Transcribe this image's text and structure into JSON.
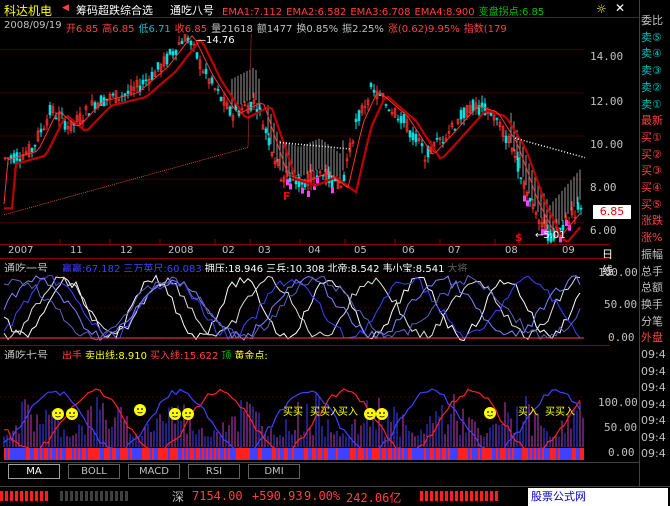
{
  "header": {
    "stock_name": "科达机电",
    "indicator_tabs": [
      "筹码超跌综合选",
      "通吃八号"
    ],
    "ema": [
      {
        "label": "EMA1:7.112",
        "color": "#ff4040"
      },
      {
        "label": "EMA2:6.582",
        "color": "#ff4040"
      },
      {
        "label": "EMA3:6.708",
        "color": "#ff4040"
      },
      {
        "label": "EMA4:8.900",
        "color": "#ff4040"
      },
      {
        "label": "变盘拐点:6.85",
        "color": "#00c000"
      }
    ],
    "date": "2008/09/19",
    "ohlc": [
      {
        "label": "开6.85",
        "color": "#ff4040"
      },
      {
        "label": "高6.85",
        "color": "#ff4040"
      },
      {
        "label": "低6.71",
        "color": "#00c0c0"
      },
      {
        "label": "收6.85",
        "color": "#ff4040"
      },
      {
        "label": "量21618",
        "color": "#c0c0c0"
      },
      {
        "label": "额1477",
        "color": "#c0c0c0"
      },
      {
        "label": "换0.85%",
        "color": "#c0c0c0"
      },
      {
        "label": "振2.25%",
        "color": "#c0c0c0"
      },
      {
        "label": "涨(0.62)9.95%",
        "color": "#ff4040"
      },
      {
        "label": "指数(179",
        "color": "#ff4040"
      }
    ]
  },
  "main_chart": {
    "y_labels": [
      "14.00",
      "12.00",
      "10.00",
      "8.00",
      "6.00"
    ],
    "high_annotation": "14.76",
    "low_annotation": "5.01",
    "current_price": "6.85",
    "x_labels": [
      "2007",
      "11",
      "12",
      "2008",
      "02",
      "03",
      "04",
      "05",
      "06",
      "07",
      "08",
      "09"
    ],
    "period": "日线"
  },
  "sub1": {
    "title": "通吃一号",
    "items": [
      {
        "label": "赢赢:67.182",
        "color": "#4040ff"
      },
      {
        "label": "三万英尺:60.083",
        "color": "#4040ff"
      },
      {
        "label": "拥压:18.946",
        "color": "#ffffff"
      },
      {
        "label": "三兵:10.308",
        "color": "#ffffff"
      },
      {
        "label": "北帝:8.542",
        "color": "#ffffff"
      },
      {
        "label": "韦小宝:8.541",
        "color": "#ffffff"
      },
      {
        "label": "大将",
        "color": "#606060"
      }
    ],
    "y_labels": [
      "100.00",
      "50.00",
      "0.00"
    ]
  },
  "sub2": {
    "title": "通吃七号",
    "items": [
      {
        "label": "出手",
        "color": "#ff4040"
      },
      {
        "label": "卖出线:8.910",
        "color": "#ffff00"
      },
      {
        "label": "买入线:15.622",
        "color": "#ff4040"
      },
      {
        "label": "顶",
        "color": "#00c000"
      },
      {
        "label": "黄金点:",
        "color": "#ffff00"
      }
    ],
    "y_labels": [
      "100.00",
      "50.00",
      "0.00"
    ],
    "buy_labels": [
      "买买",
      "买买入",
      "买入",
      "买入",
      "买买入"
    ]
  },
  "bottom_tabs": [
    "MA",
    "BOLL",
    "MACD",
    "RSI",
    "DMI"
  ],
  "sidebar": {
    "items": [
      {
        "label": "委比",
        "color": "#c0c0c0"
      },
      {
        "label": "卖⑤",
        "color": "#00c0c0"
      },
      {
        "label": "卖④",
        "color": "#00c0c0"
      },
      {
        "label": "卖③",
        "color": "#00c0c0"
      },
      {
        "label": "卖②",
        "color": "#00c0c0"
      },
      {
        "label": "卖①",
        "color": "#00c0c0"
      },
      {
        "label": "最新",
        "color": "#ff4040"
      },
      {
        "label": "买①",
        "color": "#ff4040"
      },
      {
        "label": "买②",
        "color": "#ff4040"
      },
      {
        "label": "买③",
        "color": "#ff4040"
      },
      {
        "label": "买④",
        "color": "#ff4040"
      },
      {
        "label": "买⑤",
        "color": "#ff4040"
      },
      {
        "label": "涨跌",
        "color": "#ff4040"
      },
      {
        "label": "涨%",
        "color": "#ff4040"
      },
      {
        "label": "振幅",
        "color": "#c0c0c0"
      },
      {
        "label": "总手",
        "color": "#c0c0c0"
      },
      {
        "label": "总额",
        "color": "#c0c0c0"
      },
      {
        "label": "换手",
        "color": "#c0c0c0"
      },
      {
        "label": "分笔",
        "color": "#c0c0c0"
      },
      {
        "label": "外盘",
        "color": "#ff4040"
      }
    ],
    "times": [
      "09:4",
      "09:4",
      "09:4",
      "09:4",
      "09:4",
      "09:4",
      "09:4"
    ]
  },
  "status_bar": {
    "market": "深",
    "index": "7154.00",
    "change": "+590.93",
    "percent": "9.00%",
    "amount": "242.06亿",
    "watermark": "股票公式网www.88gg.com"
  }
}
